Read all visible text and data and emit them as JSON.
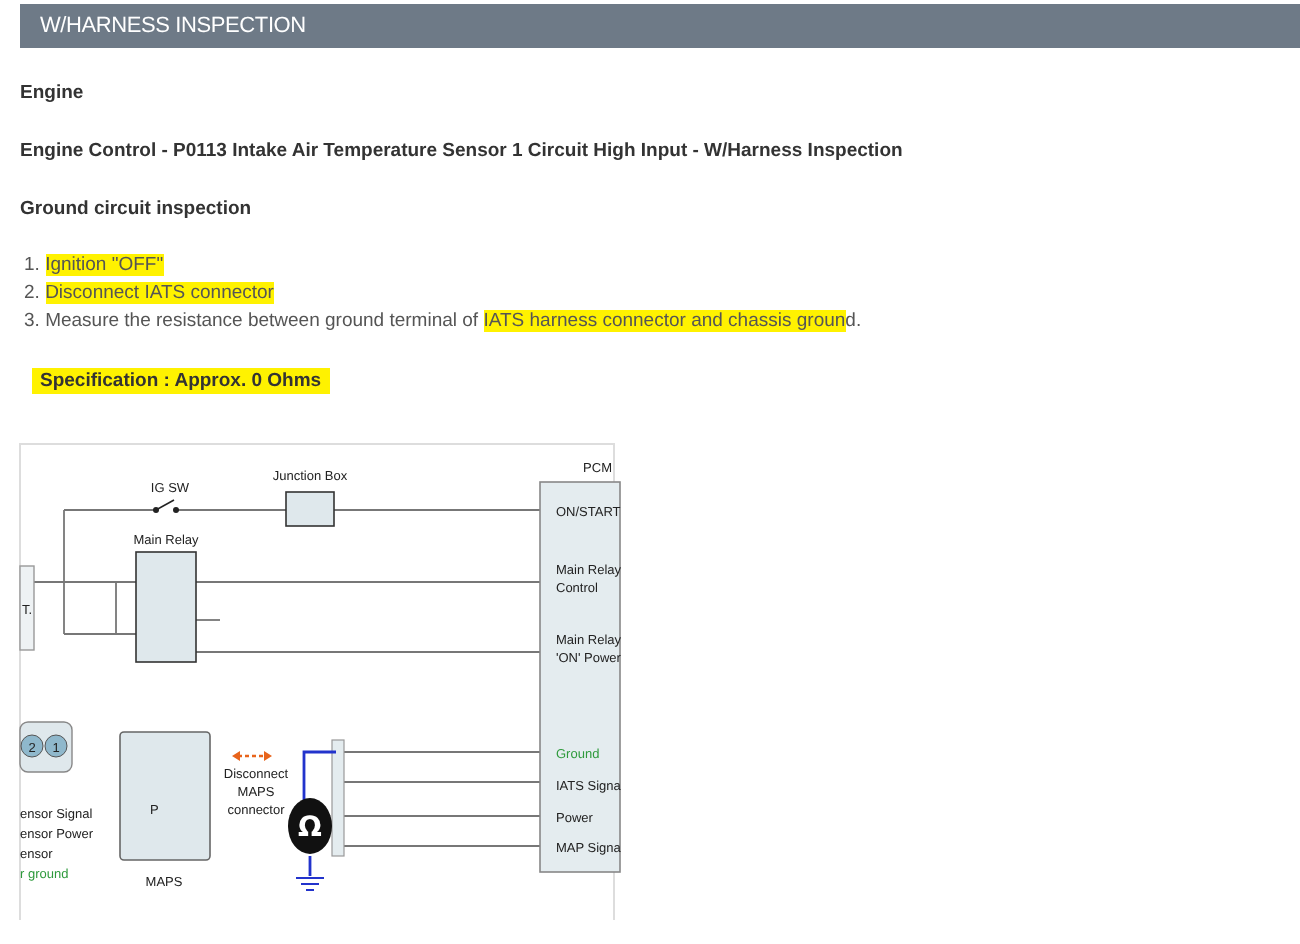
{
  "header": {
    "title": "W/HARNESS INSPECTION"
  },
  "headings": [
    "Engine",
    "Engine Control - P0113 Intake Air Temperature Sensor 1 Circuit High Input - W/Harness Inspection",
    "Ground circuit inspection"
  ],
  "steps": [
    {
      "number": "1.",
      "segments": [
        {
          "text": "Ignition \"OFF\"",
          "highlighted": true
        }
      ]
    },
    {
      "number": "2.",
      "segments": [
        {
          "text": "Disconnect IATS connector",
          "highlighted": true
        }
      ]
    },
    {
      "number": "3.",
      "segments": [
        {
          "text": "Measure the resistance between ground terminal of ",
          "highlighted": false
        },
        {
          "text": "IATS harness connector and chassis groun",
          "highlighted": true
        },
        {
          "text": "d.",
          "highlighted": false
        }
      ]
    }
  ],
  "specification": {
    "text": "Specification : Approx. 0 Ohms",
    "highlighted": true
  },
  "diagram": {
    "pcm_label": "PCM",
    "pcm_pins": [
      {
        "lines": [
          "ON/START"
        ],
        "color": "#222222"
      },
      {
        "lines": [
          "Main Relay",
          "Control"
        ],
        "color": "#222222"
      },
      {
        "lines": [
          "Main Relay",
          "'ON' Power"
        ],
        "color": "#222222"
      },
      {
        "lines": [
          "Ground"
        ],
        "color": "#2e9a3c"
      },
      {
        "lines": [
          "IATS Signa"
        ],
        "color": "#222222"
      },
      {
        "lines": [
          "Power"
        ],
        "color": "#222222"
      },
      {
        "lines": [
          "MAP Signa"
        ],
        "color": "#222222"
      }
    ],
    "ig_sw_label": "IG SW",
    "junction_box_label": "Junction Box",
    "main_relay_label": "Main Relay",
    "battery_label": "T.",
    "connector_pins": [
      "2",
      "1"
    ],
    "sensor_labels": [
      {
        "text": "ensor Signal",
        "color": "#222222"
      },
      {
        "text": "ensor Power",
        "color": "#222222"
      },
      {
        "text": "ensor",
        "color": "#222222"
      },
      {
        "text": "r ground",
        "color": "#2e9a3c"
      }
    ],
    "maps_letter": "P",
    "maps_label": "MAPS",
    "disconnect_note": [
      "Disconnect",
      "MAPS",
      "connector"
    ],
    "meter_symbol": "Ω"
  }
}
